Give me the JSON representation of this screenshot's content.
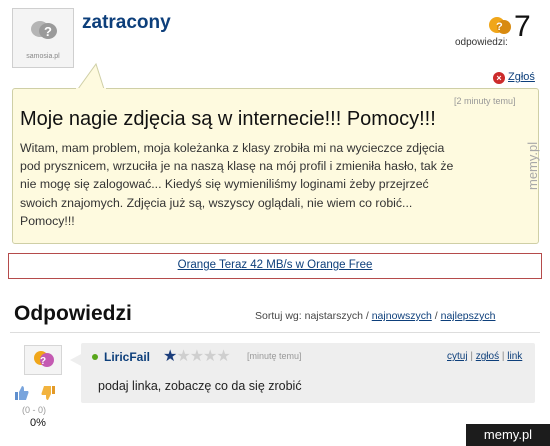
{
  "avatar": {
    "brand": "samosia.pl"
  },
  "question": {
    "author": "zatracony",
    "answers_label": "odpowiedzi:",
    "answers_count": "7",
    "report_label": "Zgłoś",
    "timestamp": "[2 minuty temu]",
    "title": "Moje nagie zdjęcia są w internecie!!! Pomocy!!!",
    "body_lines": [
      "Witam, mam problem, moja koleżanka z klasy zrobiła mi na wycieczce zdjęcia",
      "pod prysznicem, wrzuciła je na naszą klasę na mój profil i zmieniła hasło, tak że",
      "nie mogę się zalogować... Kiedyś się wymieniliśmy loginami żeby przejrzeć",
      "swoich znajomych. Zdjęcia już są, wszyscy oglądali, nie wiem co robić...",
      "Pomocy!!!"
    ]
  },
  "ad": {
    "text": "Orange Teraz 42 MB/s w Orange Free"
  },
  "answers_section": {
    "heading": "Odpowiedzi",
    "sort_label": "Sortuj wg: najstarszych /",
    "sort_newest": "najnowszych",
    "sort_sep": "/",
    "sort_best": "najlepszych"
  },
  "answer": {
    "avatar_brand": "samosia.pl",
    "author": "LiricFail",
    "stars_on": "★",
    "stars_off": "★★★★",
    "timestamp": "[minutę temu]",
    "action_quote": "cytuj",
    "action_report": "zgłoś",
    "action_link": "link",
    "sep": "|",
    "text": "podaj linka, zobaczę co da się zrobić",
    "votes": "(0 - 0)",
    "percent": "0%"
  },
  "watermarks": {
    "side": "memy.pl",
    "corner": "memy.pl"
  },
  "colors": {
    "link": "#0d3f7b",
    "question_bg": "#fefadf",
    "ad_border": "#b54b4b",
    "report_red": "#cc2b2b",
    "online_green": "#58a61a"
  }
}
